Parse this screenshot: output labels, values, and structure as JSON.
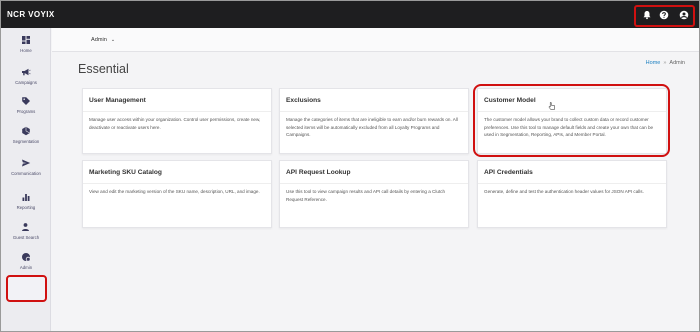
{
  "brand": {
    "logo_text": "NCR VOYIX"
  },
  "topbar": {
    "icons": [
      "bell-icon",
      "help-icon",
      "account-icon"
    ],
    "highlight_color": "#d01010"
  },
  "sidebar": {
    "items": [
      {
        "label": "Home",
        "icon": "home-icon"
      },
      {
        "label": "Campaigns",
        "icon": "megaphone-icon"
      },
      {
        "label": "Programs",
        "icon": "tag-icon"
      },
      {
        "label": "Segmentation",
        "icon": "segmentation-icon"
      },
      {
        "label": "Communication",
        "icon": "send-icon"
      },
      {
        "label": "Reporting",
        "icon": "chart-icon"
      },
      {
        "label": "Guest Search",
        "icon": "guest-search-icon"
      },
      {
        "label": "Admin",
        "icon": "admin-icon",
        "active": true
      }
    ]
  },
  "header": {
    "dropdown_label": "Admin"
  },
  "page": {
    "title": "Essential",
    "breadcrumb": {
      "home": "Home",
      "separator": "»",
      "current": "Admin"
    }
  },
  "cards": [
    {
      "title": "User Management",
      "description": "Manage user access within your organization. Control user permissions, create new, deactivate or reactivate users here."
    },
    {
      "title": "Exclusions",
      "description": "Manage the categories of items that are ineligible to earn and/or burn rewards on. All selected items will be automatically excluded from all Loyalty Programs and Campaigns."
    },
    {
      "title": "Customer Model",
      "description": "The customer model allows your brand to collect custom data or record customer preferences. Use this tool to manage default fields and create your own that can be used in Segmentation, Reporting, APIs, and Member Portal.",
      "highlighted": true
    },
    {
      "title": "Marketing SKU Catalog",
      "description": "View and edit the marketing version of the SKU name, description, URL, and image."
    },
    {
      "title": "API Request Lookup",
      "description": "Use this tool to view campaign results and API call details by entering a Clutch Request Reference."
    },
    {
      "title": "API Credentials",
      "description": "Generate, define and test the authentication header values for JSON API calls."
    }
  ],
  "colors": {
    "accent_link": "#1b7fc0",
    "topbar_bg": "#1e1e20",
    "highlight": "#d01010",
    "nav_icon": "#3a3a5c"
  }
}
